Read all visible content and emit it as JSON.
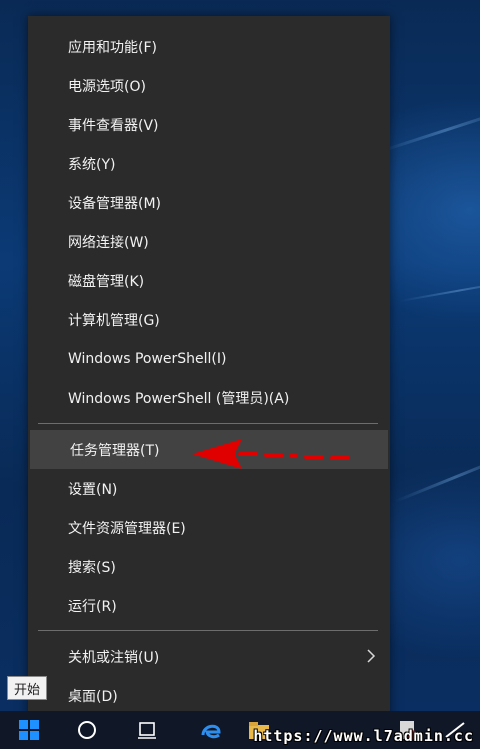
{
  "menu": {
    "items": [
      {
        "label": "应用和功能(F)"
      },
      {
        "label": "电源选项(O)"
      },
      {
        "label": "事件查看器(V)"
      },
      {
        "label": "系统(Y)"
      },
      {
        "label": "设备管理器(M)"
      },
      {
        "label": "网络连接(W)"
      },
      {
        "label": "磁盘管理(K)"
      },
      {
        "label": "计算机管理(G)"
      },
      {
        "label": "Windows PowerShell(I)"
      },
      {
        "label": "Windows PowerShell (管理员)(A)"
      },
      {
        "label": "任务管理器(T)"
      },
      {
        "label": "设置(N)"
      },
      {
        "label": "文件资源管理器(E)"
      },
      {
        "label": "搜索(S)"
      },
      {
        "label": "运行(R)"
      },
      {
        "label": "关机或注销(U)"
      },
      {
        "label": "桌面(D)"
      }
    ],
    "highlighted_item": "任务管理器(T)"
  },
  "tooltip": {
    "start_label": "开始"
  },
  "watermark": {
    "text": "https://www.l7admin.cc"
  },
  "colors": {
    "menu_bg": "#2b2b2b",
    "menu_highlight": "#424242",
    "menu_text": "#f2f2f2",
    "annotation_arrow": "#e00000",
    "start_icon": "#1e90ff"
  },
  "icons": {
    "submenu": "chevron-right-icon",
    "start": "windows-logo-icon",
    "annotation": "red-arrow-icon"
  }
}
